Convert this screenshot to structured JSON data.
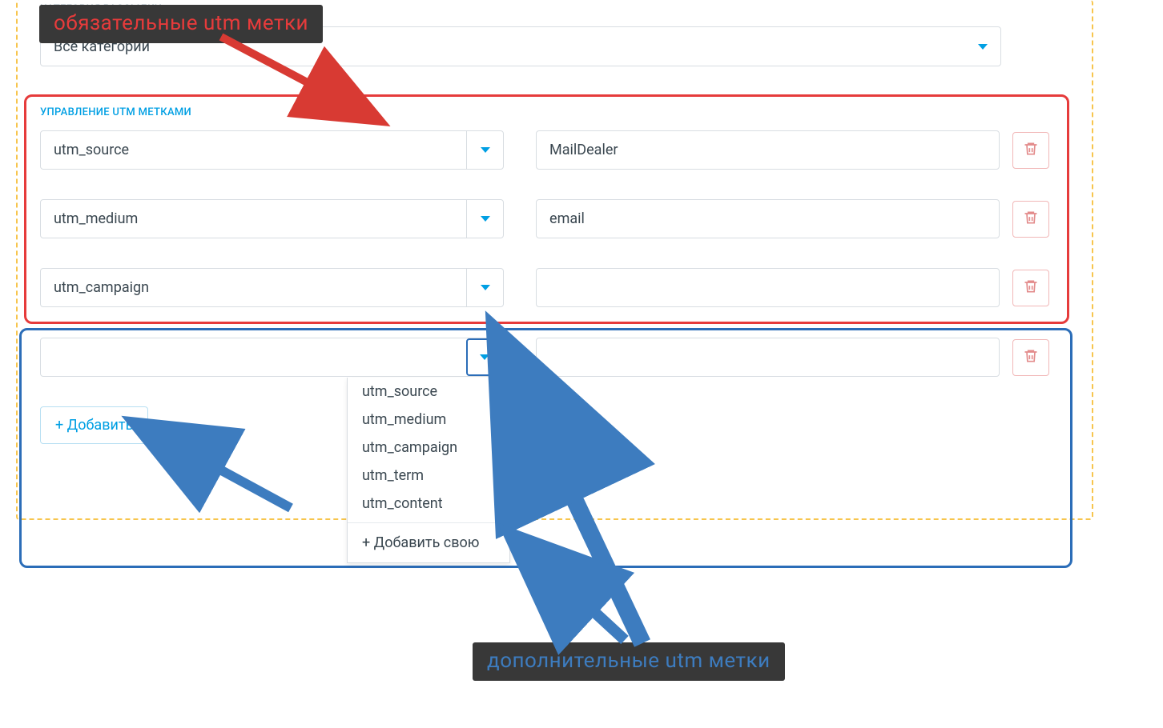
{
  "labels": {
    "category": "КАТЕГОРИЯ РАССЫЛКИ",
    "utm_section": "УПРАВЛЕНИЕ UTM МЕТКАМИ"
  },
  "category_select": {
    "value": "Все категории"
  },
  "utm_rows": [
    {
      "key": "utm_source",
      "value": "MailDealer"
    },
    {
      "key": "utm_medium",
      "value": "email"
    },
    {
      "key": "utm_campaign",
      "value": ""
    }
  ],
  "extra_row": {
    "key": "",
    "value": ""
  },
  "add_button": "+ Добавить",
  "dropdown": {
    "options": [
      "utm_source",
      "utm_medium",
      "utm_campaign",
      "utm_term",
      "utm_content"
    ],
    "add_custom": "+ Добавить свою"
  },
  "callouts": {
    "required": "обязательные utm метки",
    "optional": "дополнительные utm метки"
  },
  "colors": {
    "accent_blue": "#009fe3",
    "box_red": "#e63b3b",
    "box_blue": "#2b6db8"
  }
}
